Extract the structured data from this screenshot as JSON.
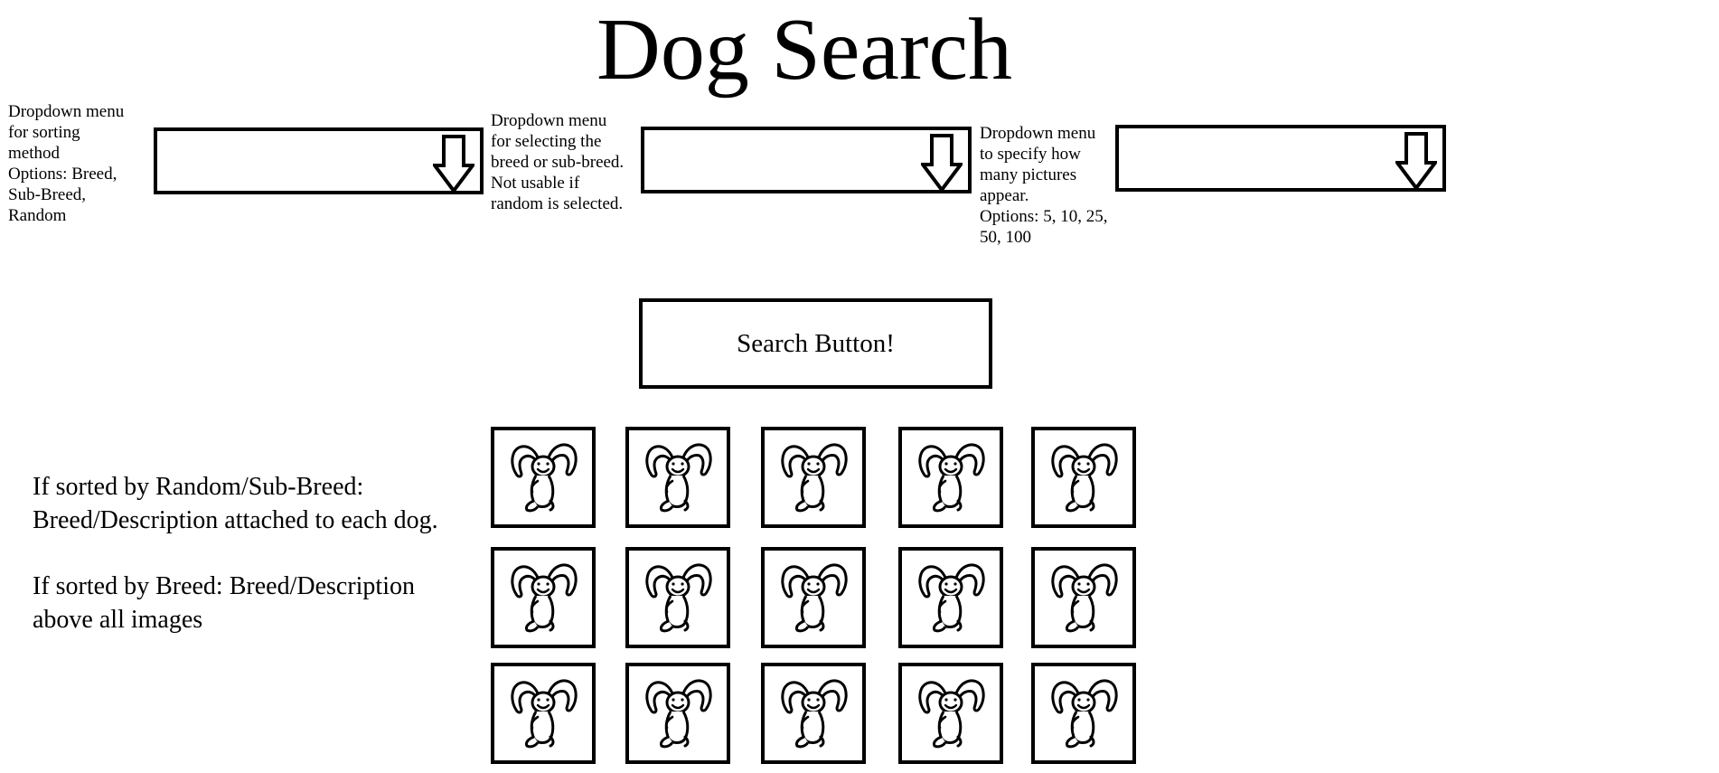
{
  "page": {
    "title": "Dog Search"
  },
  "dropdowns": [
    {
      "note_lines": [
        "Dropdown menu",
        "for sorting",
        "method",
        "Options: Breed,",
        "Sub-Breed,",
        "Random"
      ],
      "icon": "down-arrow-icon"
    },
    {
      "note_lines": [
        "Dropdown menu",
        "for selecting the",
        "breed or sub-breed.",
        "Not usable if",
        "random is selected."
      ],
      "icon": "down-arrow-icon"
    },
    {
      "note_lines": [
        "Dropdown menu",
        "to specify how",
        "many pictures",
        "appear.",
        "Options: 5, 10, 25,",
        "50, 100"
      ],
      "icon": "down-arrow-icon"
    }
  ],
  "search": {
    "button_label": "Search Button!"
  },
  "side_notes": {
    "random_note": "If sorted by Random/Sub-Breed: Breed/Description attached to each dog.",
    "breed_note": "If sorted by Breed: Breed/Description above all images"
  },
  "results": {
    "rows": 3,
    "columns": 5,
    "image_icon": "dog-icon"
  }
}
